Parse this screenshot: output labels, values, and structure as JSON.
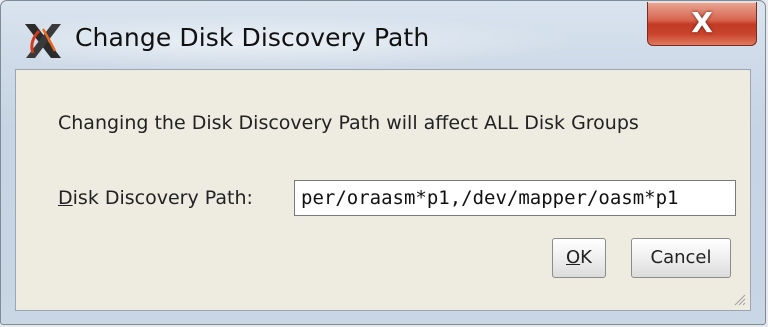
{
  "window": {
    "title": "Change Disk Discovery Path",
    "close_label": "X",
    "app_icon": "oracle-x-icon"
  },
  "dialog": {
    "message": "Changing the Disk Discovery Path will affect ALL Disk Groups",
    "field_label_mnemonic": "D",
    "field_label_rest": "isk Discovery Path:",
    "path_value": "per/oraasm*p1,/dev/mapper/oasm*p1"
  },
  "buttons": {
    "ok_mnemonic": "O",
    "ok_rest": "K",
    "cancel": "Cancel"
  },
  "colors": {
    "close_red": "#c9452d",
    "dialog_body": "#eeece1",
    "frame_blue": "#c9d6e4"
  }
}
